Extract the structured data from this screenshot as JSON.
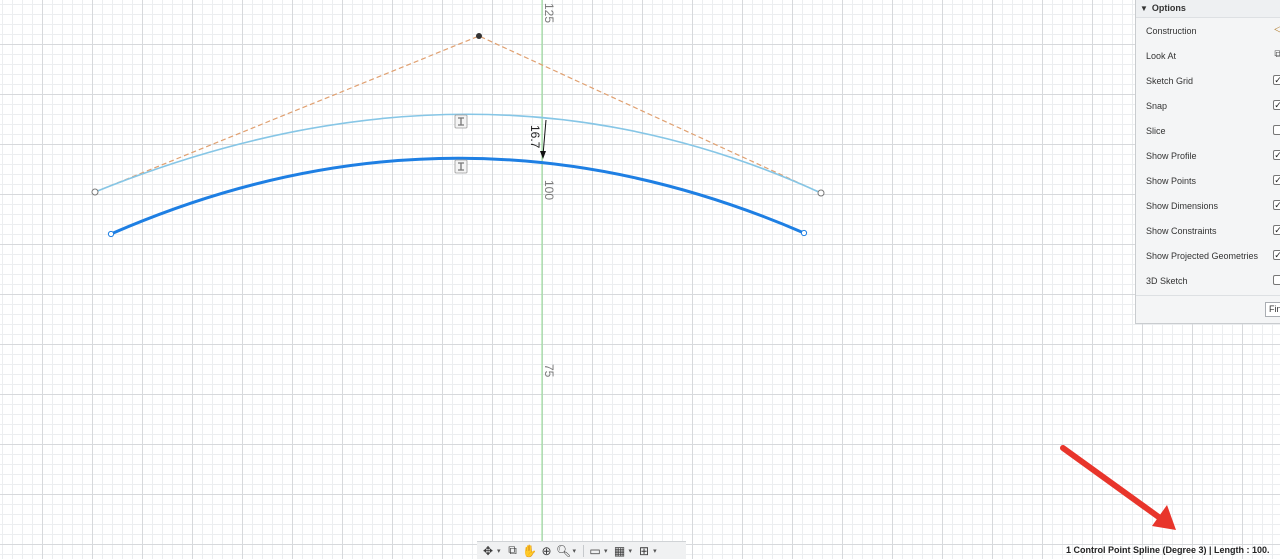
{
  "canvas": {
    "axis_labels": [
      "125",
      "100",
      "75"
    ],
    "dimension_value": "16.7",
    "colors": {
      "selected_spline": "#1e7fe3",
      "original_spline": "#86c6e6",
      "construction_line": "#e0a070",
      "axis_line": "#8fdc8f",
      "dimension_arrow": "#111111"
    }
  },
  "options_panel": {
    "title": "Options",
    "items": [
      {
        "label": "Construction",
        "control": "construction-icon",
        "checked": false
      },
      {
        "label": "Look At",
        "control": "look-at-icon",
        "checked": false
      },
      {
        "label": "Sketch Grid",
        "control": "checkbox",
        "checked": true
      },
      {
        "label": "Snap",
        "control": "checkbox",
        "checked": true
      },
      {
        "label": "Slice",
        "control": "checkbox",
        "checked": false
      },
      {
        "label": "Show Profile",
        "control": "checkbox",
        "checked": true
      },
      {
        "label": "Show Points",
        "control": "checkbox",
        "checked": true
      },
      {
        "label": "Show Dimensions",
        "control": "checkbox",
        "checked": true
      },
      {
        "label": "Show Constraints",
        "control": "checkbox",
        "checked": true
      },
      {
        "label": "Show Projected Geometries",
        "control": "checkbox",
        "checked": true
      },
      {
        "label": "3D Sketch",
        "control": "checkbox",
        "checked": false
      }
    ],
    "finish_label": "Fin"
  },
  "toolbar": {
    "buttons": [
      "orbit-icon",
      "look-at-icon",
      "pan-icon",
      "zoom-window-icon",
      "zoom-icon",
      "display-settings-icon",
      "grid-icon",
      "viewports-icon"
    ]
  },
  "status_bar": {
    "text": "1 Control Point Spline (Degree 3) | Length : 100."
  },
  "annotation": {
    "arrow_color": "#e8352b"
  }
}
